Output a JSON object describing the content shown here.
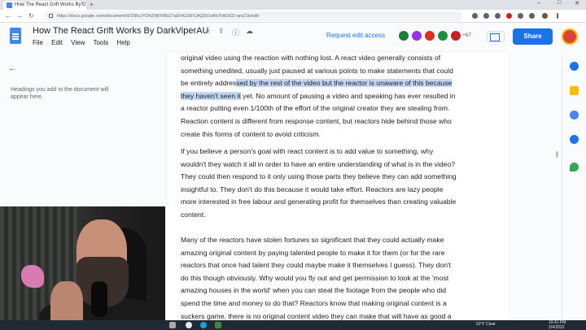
{
  "browser": {
    "tab_title": "How The React Grift Works By D",
    "url": "https://docs.google.com/document/d/15BxJYDhZWjYiRb27aEFtGiSFCAQDOuRkTHtOGD-qmZ1k/edit",
    "nav": {
      "back": "←",
      "forward": "→",
      "reload": "↻",
      "new_tab": "+",
      "close": "×"
    },
    "window_controls": {
      "minimize": "–",
      "maximize": "□",
      "close": "✕"
    }
  },
  "docs": {
    "title": "How The React Grift Works By DarkViperAU",
    "menu": [
      "File",
      "Edit",
      "View",
      "Tools",
      "Help"
    ],
    "request_edit": "Request edit access",
    "more_collaborators": "+67",
    "share_label": "Share",
    "title_icons": [
      "☆",
      "⇪",
      "ⓘ",
      "☁"
    ],
    "avatar_colors": [
      "#188038",
      "#9334e6",
      "#d93025",
      "#1e8e3e",
      "#c5221f"
    ]
  },
  "outline": {
    "hint": "Headings you add to the document will appear here."
  },
  "document": {
    "p1_pre": "original video using the reaction with nothing lost. A react video generally consists of something unedited, usually just paused at various points to make statements that could be entirely addres",
    "p1_hl": "sed by the rest of the video but the reactor is unaware of this because they haven't seen it",
    "p1_post": " yet. No amount of pausing a video and speaking has ever resulted in a reactor putting even 1/100th of the effort of the original creator they are stealing from. Reaction content is different from response content, but reactors hide behind those who create this forms of content to avoid criticism.",
    "p2": "If you believe a person's goal with react content is to add value to something, why wouldn't they watch it all in order to have an entire understanding of what is in the video? They could then respond to it only using those parts they believe they can add something insightful to. They don't do this because it would take effort. Reactors are lazy people more interested in free labour and generating profit for themselves than creating valuable content.",
    "p3": "Many of the reactors have stolen fortunes so significant that they could actually make amazing original content by paying talented people to make it for them (or for the rare reactors that once had talent they could maybe make it themselves I guess). They don't do this though obviously. Why would you fly out and get permission to look at the 'most amazing houses in the world' when you can steal the footage from the people who did spend the time and money to do that? Reactors know that making original content is a suckers game, there is no original content video they can make that will have as good a"
  },
  "taskbar": {
    "weather": "52°F Clear",
    "time": "10:41 PM",
    "date": "2/4/2022"
  },
  "colors": {
    "accent": "#1a73e8",
    "selection": "#c2d7f5"
  }
}
